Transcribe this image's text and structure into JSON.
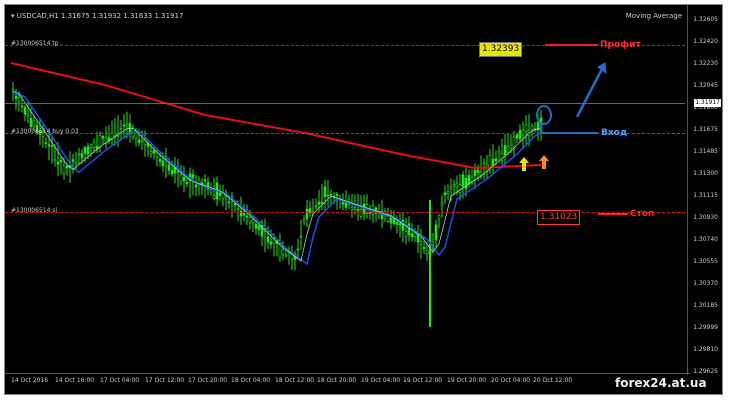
{
  "header": {
    "ticker": "▾ USDCAD,H1  1.31675 1.31932 1.31633 1.31917",
    "indicator": "Moving Average"
  },
  "levels": {
    "tp": "#130006514 tp",
    "entry": "#130006514 buy 0.03",
    "sl": "#130006514 sl"
  },
  "price_axis": [
    "1.32605",
    "1.32420",
    "1.32230",
    "1.32045",
    "1.31860",
    "1.31675",
    "1.31485",
    "1.31300",
    "1.31115",
    "1.30930",
    "1.30740",
    "1.30555",
    "1.30370",
    "1.30185",
    "1.29999",
    "1.29810",
    "1.29625"
  ],
  "current_price": "1.31917",
  "time_axis": [
    "14 Oct 2016",
    "14 Oct 16:00",
    "17 Oct 04:00",
    "17 Oct 12:00",
    "17 Oct 20:00",
    "18 Oct 04:00",
    "18 Oct 12:00",
    "18 Oct 20:00",
    "19 Oct 04:00",
    "19 Oct 12:00",
    "19 Oct 20:00",
    "20 Oct 04:00",
    "20 Oct 12:00"
  ],
  "chips": {
    "tp": "1.32393",
    "sl": "1.31023"
  },
  "annotations": {
    "tp": "Профит",
    "entry": "Вход",
    "sl": "Стоп"
  },
  "brand": "forex24.at.ua",
  "colors": {
    "background": "#000000",
    "bull": "#26e21f",
    "ma_slow": "#e11111",
    "ma_fast": "#1f4fe8",
    "ma_signal": "#8fe0c0",
    "annotation_blue": "#1f6fc8"
  }
}
